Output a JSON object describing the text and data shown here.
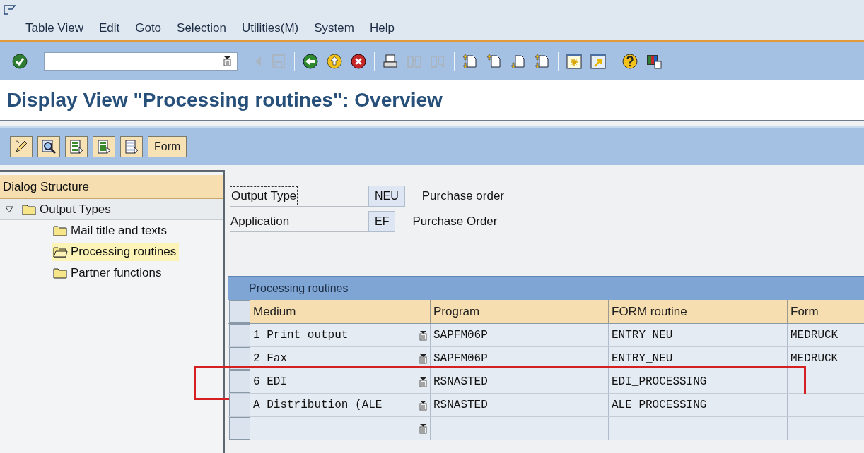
{
  "menu_bar": [
    "Table View",
    "Edit",
    "Goto",
    "Selection",
    "Utilities(M)",
    "System",
    "Help"
  ],
  "toolbar": [
    {
      "kind": "enter",
      "disabled": false
    },
    {
      "kind": "command-field"
    },
    {
      "kind": "back-arrow",
      "disabled": true
    },
    {
      "kind": "save",
      "disabled": true
    },
    {
      "kind": "separator"
    },
    {
      "kind": "back",
      "disabled": false
    },
    {
      "kind": "exit",
      "disabled": false
    },
    {
      "kind": "cancel",
      "disabled": false
    },
    {
      "kind": "separator"
    },
    {
      "kind": "print",
      "disabled": false
    },
    {
      "kind": "find",
      "disabled": true
    },
    {
      "kind": "find-next",
      "disabled": true
    },
    {
      "kind": "separator"
    },
    {
      "kind": "first-page",
      "disabled": false
    },
    {
      "kind": "previous-page",
      "disabled": false
    },
    {
      "kind": "next-page",
      "disabled": false
    },
    {
      "kind": "last-page",
      "disabled": false
    },
    {
      "kind": "separator"
    },
    {
      "kind": "new-session",
      "disabled": false
    },
    {
      "kind": "shortcut",
      "disabled": false
    },
    {
      "kind": "separator"
    },
    {
      "kind": "help",
      "disabled": false
    },
    {
      "kind": "layout",
      "disabled": false
    }
  ],
  "title": "Display View \"Processing routines\": Overview",
  "app_toolbar": [
    {
      "kind": "edit"
    },
    {
      "kind": "find"
    },
    {
      "kind": "select-all"
    },
    {
      "kind": "select-block"
    },
    {
      "kind": "deselect-all"
    },
    {
      "kind": "text",
      "label": "Form"
    }
  ],
  "dialog_structure": {
    "title": "Dialog Structure",
    "items": [
      {
        "label": "Output Types",
        "selected": false,
        "expanded": true,
        "children": [
          {
            "label": "Mail title and texts",
            "selected": false
          },
          {
            "label": "Processing routines",
            "selected": true
          },
          {
            "label": "Partner functions",
            "selected": false
          }
        ]
      }
    ]
  },
  "fields": [
    {
      "label": "Output Type",
      "value": "NEU",
      "description": "Purchase order",
      "focused": true
    },
    {
      "label": "Application",
      "value": "EF",
      "description": "Purchase Order",
      "focused": false
    }
  ],
  "table": {
    "title": "Processing routines",
    "columns": [
      "Medium",
      "Program",
      "FORM routine",
      "Form"
    ],
    "rows": [
      {
        "medium": "1 Print output",
        "program": "SAPFM06P",
        "form_routine": "ENTRY_NEU",
        "form": "MEDRUCK",
        "highlighted": false
      },
      {
        "medium": "2 Fax",
        "program": "SAPFM06P",
        "form_routine": "ENTRY_NEU",
        "form": "MEDRUCK",
        "highlighted": false
      },
      {
        "medium": "6 EDI",
        "program": "RSNASTED",
        "form_routine": "EDI_PROCESSING",
        "highlighted": true
      },
      {
        "medium": "A Distribution (ALE",
        "program": "RSNASTED",
        "form_routine": "ALE_PROCESSING",
        "highlighted": false
      },
      {
        "highlighted": false
      }
    ]
  }
}
